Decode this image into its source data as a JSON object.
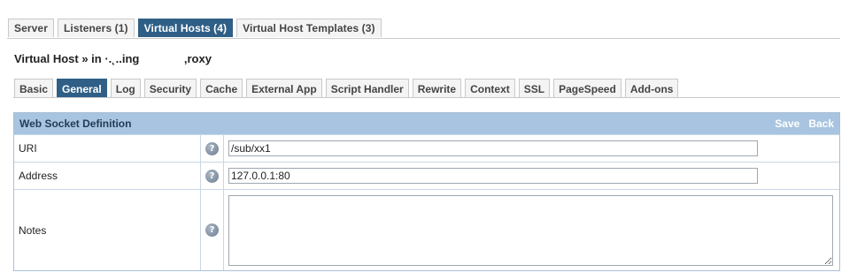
{
  "top_tabs": [
    {
      "label": "Server",
      "active": false
    },
    {
      "label": "Listeners (1)",
      "active": false
    },
    {
      "label": "Virtual Hosts (4)",
      "active": true
    },
    {
      "label": "Virtual Host Templates (3)",
      "active": false
    }
  ],
  "breadcrumb": "Virtual Host » in ·.˛..ing              ,roxy",
  "sub_tabs": [
    {
      "label": "Basic",
      "active": false
    },
    {
      "label": "General",
      "active": true
    },
    {
      "label": "Log",
      "active": false
    },
    {
      "label": "Security",
      "active": false
    },
    {
      "label": "Cache",
      "active": false
    },
    {
      "label": "External App",
      "active": false
    },
    {
      "label": "Script Handler",
      "active": false
    },
    {
      "label": "Rewrite",
      "active": false
    },
    {
      "label": "Context",
      "active": false
    },
    {
      "label": "SSL",
      "active": false
    },
    {
      "label": "PageSpeed",
      "active": false
    },
    {
      "label": "Add-ons",
      "active": false
    }
  ],
  "panel": {
    "title": "Web Socket Definition",
    "save_label": "Save",
    "back_label": "Back",
    "fields": {
      "uri": {
        "label": "URI",
        "value": "/sub/xx1"
      },
      "address": {
        "label": "Address",
        "value": "127.0.0.1:80"
      },
      "notes": {
        "label": "Notes",
        "value": ""
      }
    },
    "help_glyph": "?"
  },
  "icons": {
    "help": "help-question-icon",
    "resize": "resize-grip-icon"
  },
  "colors": {
    "active_tab": "#2f5f86",
    "panel_header": "#a8c4e0"
  }
}
